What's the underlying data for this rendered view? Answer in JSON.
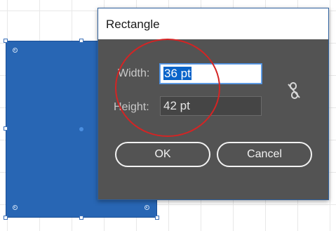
{
  "dialog": {
    "title": "Rectangle",
    "width": {
      "label": "Width:",
      "value": "36 pt"
    },
    "height": {
      "label": "Height:",
      "value": "42 pt"
    },
    "constrain_icon": "unlink-chain-icon",
    "buttons": {
      "ok": "OK",
      "cancel": "Cancel"
    }
  },
  "canvas": {
    "rectangle_fill": "#2866b4",
    "annotation_color": "#d42424"
  }
}
